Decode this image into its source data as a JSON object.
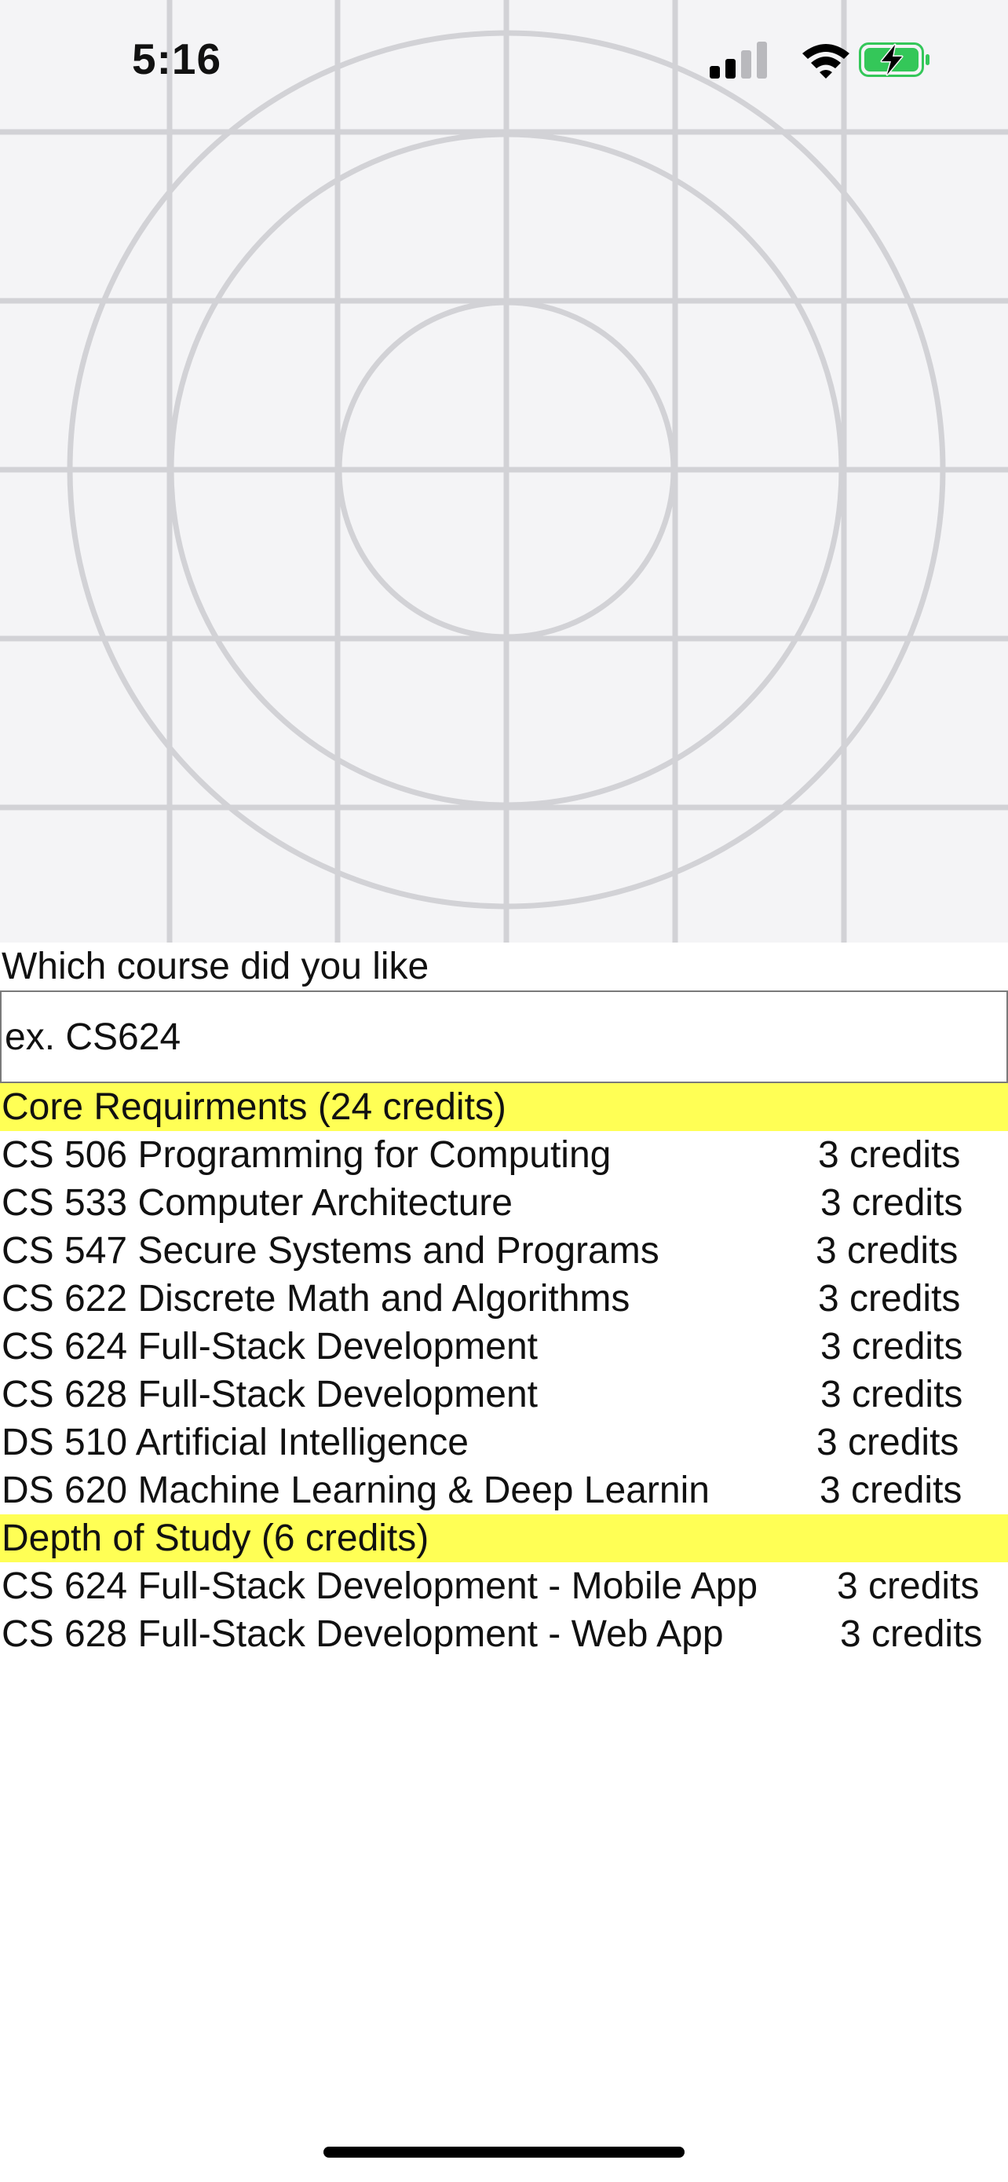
{
  "status_bar": {
    "time": "5:16"
  },
  "course_prompt": {
    "label": "Which course did you like",
    "input_placeholder": "ex. CS624"
  },
  "sections": [
    {
      "title": "Core Requirments (24 credits)",
      "courses": [
        {
          "name": "CS 506 Programming for Computing",
          "credits": "3 credits"
        },
        {
          "name": "CS 533 Computer Architecture",
          "credits": "3 credits"
        },
        {
          "name": "CS 547 Secure Systems and Programs",
          "credits": "3 credits"
        },
        {
          "name": "CS 622 Discrete Math and Algorithms",
          "credits": "3 credits"
        },
        {
          "name": "CS 624 Full-Stack Development",
          "credits": "3 credits"
        },
        {
          "name": "CS 628 Full-Stack Development",
          "credits": "3 credits"
        },
        {
          "name": "DS 510 Artificial Intelligence",
          "credits": "3 credits"
        },
        {
          "name": "DS 620 Machine Learning & Deep Learnin",
          "credits": "3 credits"
        }
      ]
    },
    {
      "title": "Depth of Study (6 credits)",
      "courses": [
        {
          "name": "CS 624 Full-Stack Development - Mobile App",
          "credits": "3 credits"
        },
        {
          "name": "CS 628 Full-Stack Development - Web App",
          "credits": "3 credits"
        }
      ]
    }
  ],
  "colors": {
    "section_highlight": "#ffff55",
    "placeholder_background": "#f4f4f6",
    "placeholder_lines": "#d2d2d6",
    "battery_charging": "#34c759"
  },
  "icons": {
    "placeholder_image": "image-placeholder-icon",
    "signal": "cellular-signal-icon",
    "wifi": "wifi-icon",
    "battery": "battery-charging-icon"
  }
}
